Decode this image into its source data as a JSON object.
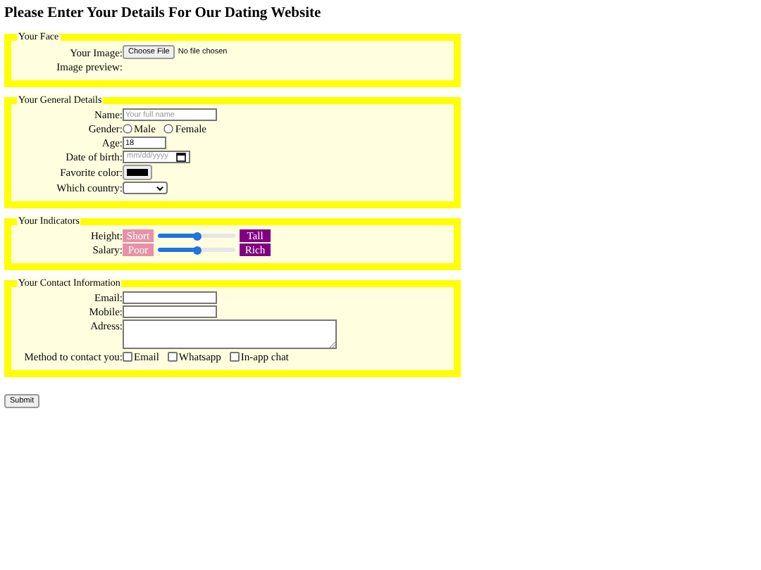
{
  "heading": "Please Enter Your Details For Our Dating Website",
  "sections": [
    {
      "legend": "Your Face",
      "rows": [
        {
          "kind": "file",
          "label": "Your Image:",
          "button": "Choose File",
          "status": "No file chosen"
        },
        {
          "kind": "preview",
          "label": "Image preview:"
        }
      ]
    },
    {
      "legend": "Your General Details",
      "rows": [
        {
          "kind": "text",
          "label": "Name:",
          "placeholder": "Your full name"
        },
        {
          "kind": "radio",
          "label": "Gender:",
          "options": [
            {
              "label": "Male",
              "selected": false
            },
            {
              "label": "Female",
              "selected": false
            }
          ]
        },
        {
          "kind": "number",
          "label": "Age:",
          "value": "18"
        },
        {
          "kind": "date",
          "label": "Date of birth:",
          "placeholder": "mm/dd/yyyy"
        },
        {
          "kind": "color",
          "label": "Favorite color:",
          "color": "#000000"
        },
        {
          "kind": "select",
          "label": "Which country:"
        }
      ]
    },
    {
      "legend": "Your Indicators",
      "rows": [
        {
          "kind": "range",
          "label": "Height:",
          "low": "Short",
          "level": 0.5,
          "high": "Tall"
        },
        {
          "kind": "range",
          "label": "Salary:",
          "low": "Poor",
          "level": 0.5,
          "high": "Rich"
        }
      ]
    },
    {
      "legend": "Your Contact Information",
      "rows": [
        {
          "kind": "text",
          "label": "Email:"
        },
        {
          "kind": "text",
          "label": "Mobile:"
        },
        {
          "kind": "textarea",
          "label": "Adress:"
        },
        {
          "kind": "checks",
          "label": "Method to contact you:",
          "options": [
            {
              "label": "Email",
              "checked": false
            },
            {
              "label": "Whatsapp",
              "checked": false
            },
            {
              "label": "In-app chat",
              "checked": false
            }
          ]
        }
      ]
    }
  ],
  "submit": "Submit"
}
